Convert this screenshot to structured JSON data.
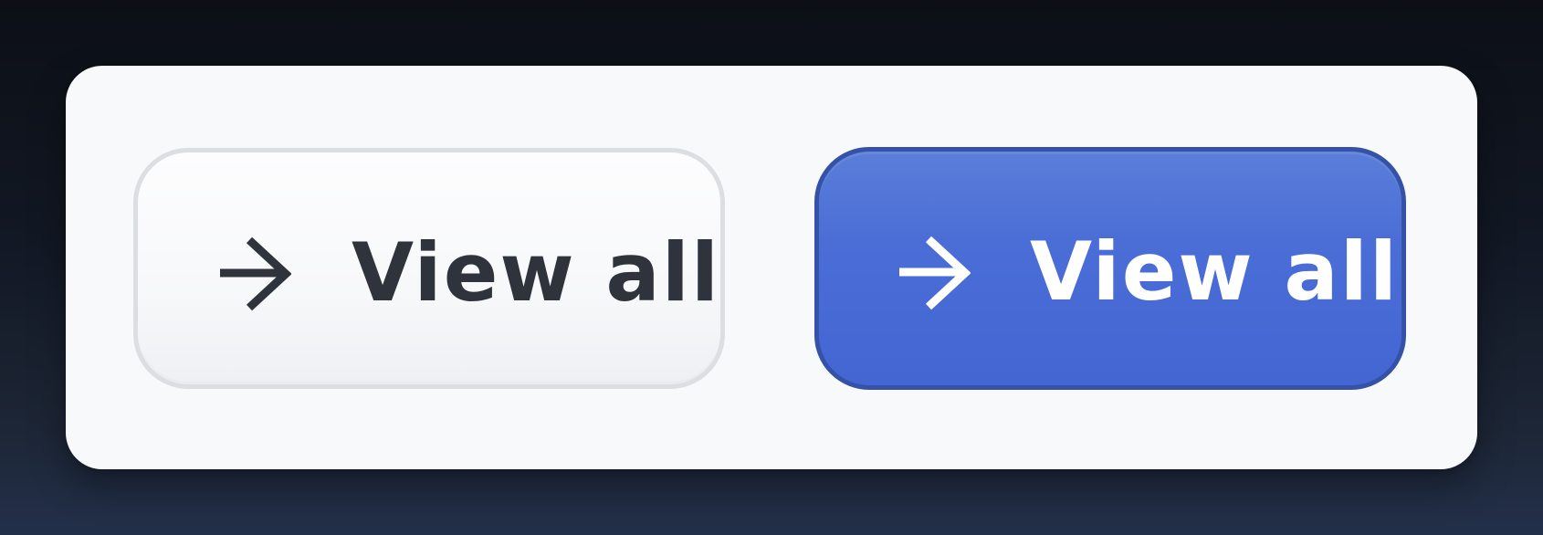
{
  "buttons": {
    "secondary": {
      "label": "View all",
      "icon": "arrow-right-icon",
      "text_color": "#2f333b",
      "background": "#f8f9fb",
      "border_color": "#dcdee2"
    },
    "primary": {
      "label": "View all",
      "icon": "arrow-right-icon",
      "text_color": "#ffffff",
      "background": "#4a6dd6",
      "border_color": "#3552a8"
    }
  }
}
